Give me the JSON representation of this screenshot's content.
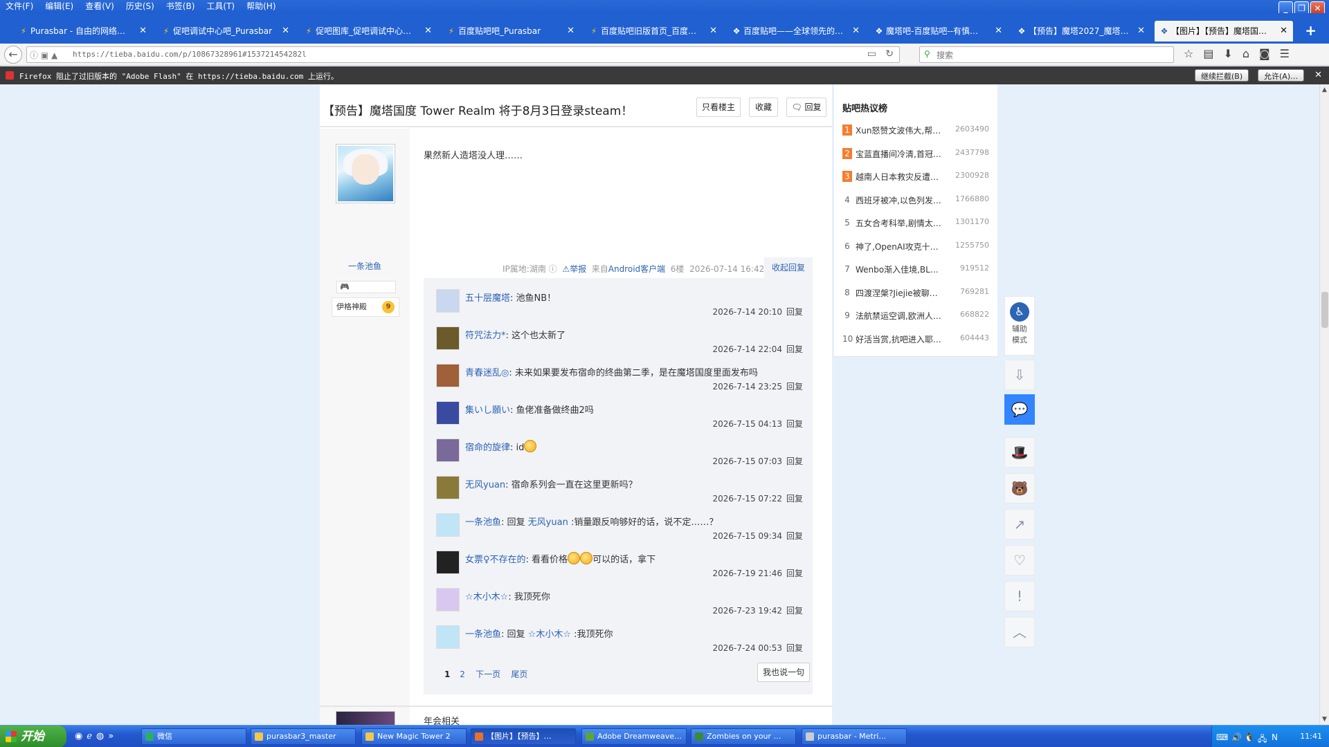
{
  "menubar": {
    "items": [
      "文件(F)",
      "编辑(E)",
      "查看(V)",
      "历史(S)",
      "书签(B)",
      "工具(T)",
      "帮助(H)"
    ]
  },
  "tabs": [
    {
      "title": "Purasbar - 自由的网络…",
      "icon": "tieba-icon"
    },
    {
      "title": "促吧调试中心吧_Purasbar",
      "icon": "tieba-icon"
    },
    {
      "title": "促吧图库_促吧调试中心…",
      "icon": "tieba-icon"
    },
    {
      "title": "百度贴吧吧_Purasbar",
      "icon": "tieba-icon"
    },
    {
      "title": "百度贴吧旧版首页_百度…",
      "icon": "tieba-icon"
    },
    {
      "title": "百度贴吧——全球领先的…",
      "icon": "baidu-icon"
    },
    {
      "title": "魔塔吧-百度贴吧--有慎…",
      "icon": "baidu-icon"
    },
    {
      "title": "【预告】魔塔2027_魔塔…",
      "icon": "baidu-icon"
    },
    {
      "title": "【图片】【预告】魔塔国…",
      "icon": "baidu-icon",
      "active": true
    }
  ],
  "nav": {
    "url": "https://tieba.baidu.com/p/10867328961#153721454282l",
    "search_placeholder": "搜索"
  },
  "flash": {
    "message": "Firefox 阻止了过旧版本的 \"Adobe Flash\" 在 https://tieba.baidu.com 上运行。",
    "continue_label": "继续拦截(B)",
    "allow_label": "允许(A)…"
  },
  "post": {
    "title": "【预告】魔塔国度 Tower Realm 将于8月3日登录steam！",
    "only_op_label": "只看楼主",
    "collect_label": "收藏",
    "reply_label": "回复",
    "content": "果然新人造塔没人理……",
    "author": {
      "name": "一条池鱼",
      "level_name": "伊格神殿",
      "level": "9"
    },
    "tail": {
      "ip": "IP属地:湖南",
      "report": "举报",
      "client_prefix": "来自",
      "client": "Android客户端",
      "floor": "6楼",
      "time": "2026-07-14 16:42"
    },
    "collapse_label": "收起回复"
  },
  "replies": [
    {
      "user": "五十层魔塔",
      "sep": ": ",
      "text": "池鱼NB！",
      "time": "2026-7-14 20:10",
      "reply": "回复",
      "avatar": "#c9d8ee"
    },
    {
      "user": "符咒法力*",
      "sep": ": ",
      "text": "这个也太新了",
      "time": "2026-7-14 22:04",
      "reply": "回复",
      "avatar": "#6b5a2a"
    },
    {
      "user": "青春迷乱◎",
      "sep": ": ",
      "text": "未来如果要发布宿命的终曲第二季，是在魔塔国度里面发布吗",
      "time": "2026-7-14 23:25",
      "reply": "回复",
      "avatar": "#a0603a"
    },
    {
      "user": "集いし願い",
      "sep": ": ",
      "text": "鱼佬准备做终曲2吗",
      "time": "2026-7-15 04:13",
      "reply": "回复",
      "avatar": "#3a4aa0"
    },
    {
      "user": "宿命的旋律",
      "sep": ": ",
      "text": "id",
      "emoji_count": 1,
      "time": "2026-7-15 07:03",
      "reply": "回复",
      "avatar": "#7a6a9a"
    },
    {
      "user": "无风yuan",
      "sep": ": ",
      "text": "宿命系列会一直在这里更新吗？",
      "time": "2026-7-15 07:22",
      "reply": "回复",
      "avatar": "#8a7a3a"
    },
    {
      "user": "一条池鱼",
      "sep": ": ",
      "text_prefix": "回复 ",
      "mention": "无风yuan",
      "text": " :销量跟反响够好的话，说不定……？",
      "time": "2026-7-15 09:34",
      "reply": "回复",
      "avatar": "#bfe5f7"
    },
    {
      "user": "女票♀不存在的",
      "sep": ": ",
      "text": "看看价格",
      "emoji_count": 2,
      "text_after": "可以的话，拿下",
      "time": "2026-7-19 21:46",
      "reply": "回复",
      "avatar": "#222222"
    },
    {
      "user": "☆木小木☆",
      "sep": ": ",
      "text": "我顶死你",
      "time": "2026-7-23 19:42",
      "reply": "回复",
      "avatar": "#d8c8f0"
    },
    {
      "user": "一条池鱼",
      "sep": ": ",
      "text_prefix": "回复 ",
      "mention": "☆木小木☆",
      "text": " :我顶死你",
      "time": "2026-7-24 00:53",
      "reply": "回复",
      "avatar": "#bfe5f7"
    }
  ],
  "pager": {
    "current": "1",
    "page2": "2",
    "next": "下一页",
    "last": "尾页",
    "say_label": "我也说一句"
  },
  "next_floor_text": "年会相关",
  "hot": {
    "title": "贴吧热议榜",
    "items": [
      {
        "rank": "1",
        "text": "Xun怒赞文波伟大,帮…",
        "count": "2603490"
      },
      {
        "rank": "2",
        "text": "宝蓝直播间冷清,首冠…",
        "count": "2437798"
      },
      {
        "rank": "3",
        "text": "越南人日本救灾反遭…",
        "count": "2300928"
      },
      {
        "rank": "4",
        "text": "西班牙被冲,以色列发…",
        "count": "1766880"
      },
      {
        "rank": "5",
        "text": "五女合考科举,剧情太…",
        "count": "1301170"
      },
      {
        "rank": "6",
        "text": "神了,OpenAI攻克十…",
        "count": "1255750"
      },
      {
        "rank": "7",
        "text": "Wenbo渐入佳境,BL…",
        "count": "919512"
      },
      {
        "rank": "8",
        "text": "四渡涅槃?Jiejie被聊…",
        "count": "769281"
      },
      {
        "rank": "9",
        "text": "法航禁运空调,欧洲人…",
        "count": "668822"
      },
      {
        "rank": "10",
        "text": "好活当赏,抗吧进入耶…",
        "count": "604443"
      }
    ]
  },
  "side": {
    "assist_label_1": "辅助",
    "assist_label_2": "模式"
  },
  "taskbar": {
    "start": "开始",
    "tasks": [
      {
        "label": "微信",
        "icon_color": "#2aae67"
      },
      {
        "label": "purasbar3_master",
        "icon_color": "#f3c74a"
      },
      {
        "label": "New Magic Tower 2",
        "icon_color": "#f3c74a"
      },
      {
        "label": "【图片】【预告】…",
        "icon_color": "#e8702a",
        "active": true
      },
      {
        "label": "Adobe Dreamweave…",
        "icon_color": "#5ba639"
      },
      {
        "label": "Zombies on your …",
        "icon_color": "#3a8a3a"
      },
      {
        "label": "purasbar - Metri…",
        "icon_color": "#cccccc"
      }
    ],
    "clock": "11:41"
  },
  "colors": {
    "accent": "#2d64b3",
    "page_bg": "#e6f0fb",
    "hot_rank": "#f57d2f",
    "side_active": "#3385ff"
  }
}
